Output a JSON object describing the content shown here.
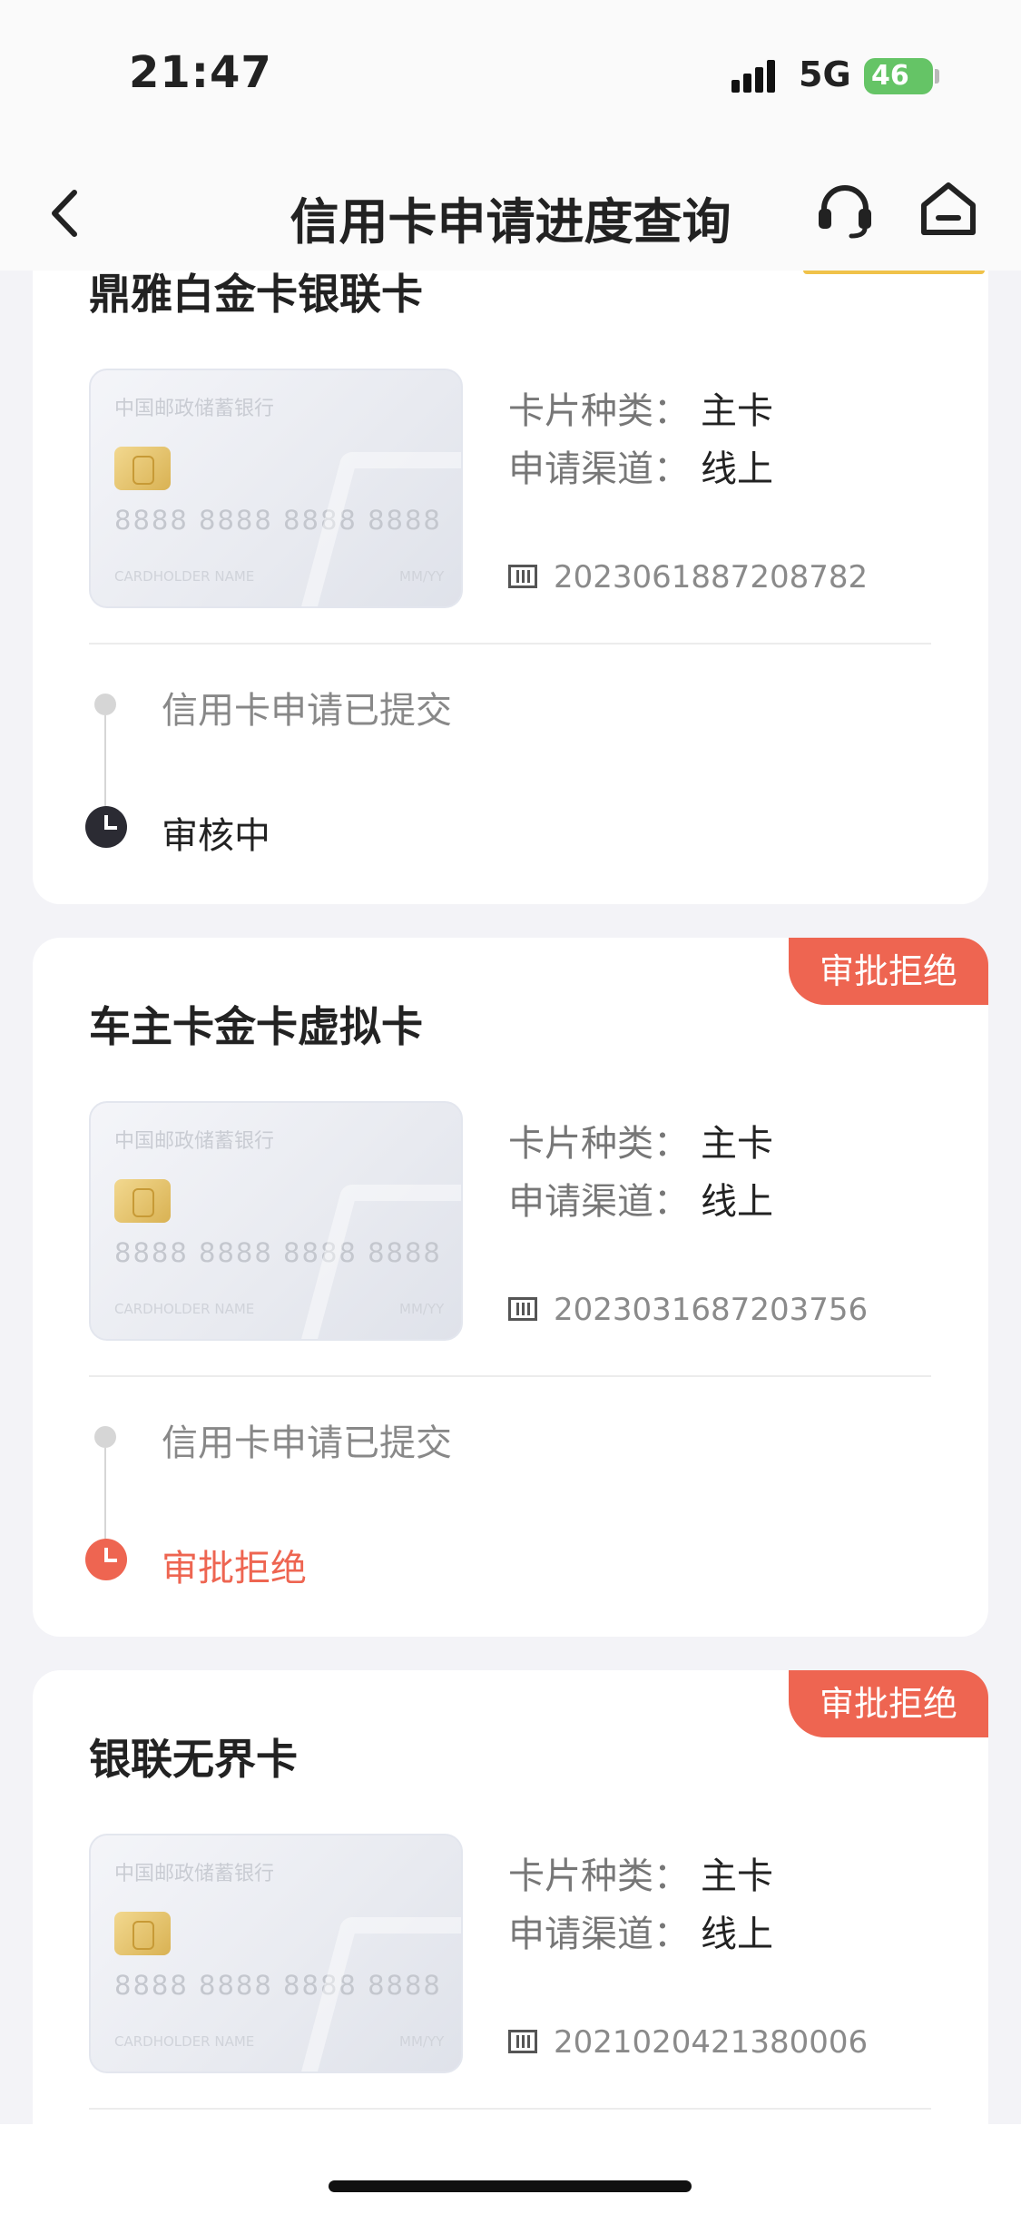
{
  "status_bar": {
    "time": "21:47",
    "network": "5G",
    "battery": "46"
  },
  "header": {
    "title": "信用卡申请进度查询"
  },
  "applications": [
    {
      "name": "鼎雅白金卡银联卡",
      "badge": "",
      "card_type_label": "卡片种类：",
      "card_type": "主卡",
      "channel_label": "申请渠道：",
      "channel": "线上",
      "app_no": "2023061887208782",
      "card_image": {
        "bank": "中国邮政储蓄银行",
        "number": "8888 8888 8888 8888",
        "holder": "CARDHOLDER NAME",
        "valid": "MM/YY"
      },
      "timeline": {
        "step1": "信用卡申请已提交",
        "step2": "审核中",
        "step2_color": "#222222"
      }
    },
    {
      "name": "车主卡金卡虚拟卡",
      "badge": "审批拒绝",
      "card_type_label": "卡片种类：",
      "card_type": "主卡",
      "channel_label": "申请渠道：",
      "channel": "线上",
      "app_no": "2023031687203756",
      "card_image": {
        "bank": "中国邮政储蓄银行",
        "number": "8888 8888 8888 8888",
        "holder": "CARDHOLDER NAME",
        "valid": "MM/YY"
      },
      "timeline": {
        "step1": "信用卡申请已提交",
        "step2": "审批拒绝",
        "step2_color": "#ee6551"
      }
    },
    {
      "name": "银联无界卡",
      "badge": "审批拒绝",
      "card_type_label": "卡片种类：",
      "card_type": "主卡",
      "channel_label": "申请渠道：",
      "channel": "线上",
      "app_no": "2021020421380006",
      "card_image": {
        "bank": "中国邮政储蓄银行",
        "number": "8888 8888 8888 8888",
        "holder": "CARDHOLDER NAME",
        "valid": "MM/YY"
      }
    }
  ],
  "colors": {
    "accent_red": "#ee6551",
    "accent_gold": "#f0c24a",
    "pending_dark": "#2b2b33"
  }
}
